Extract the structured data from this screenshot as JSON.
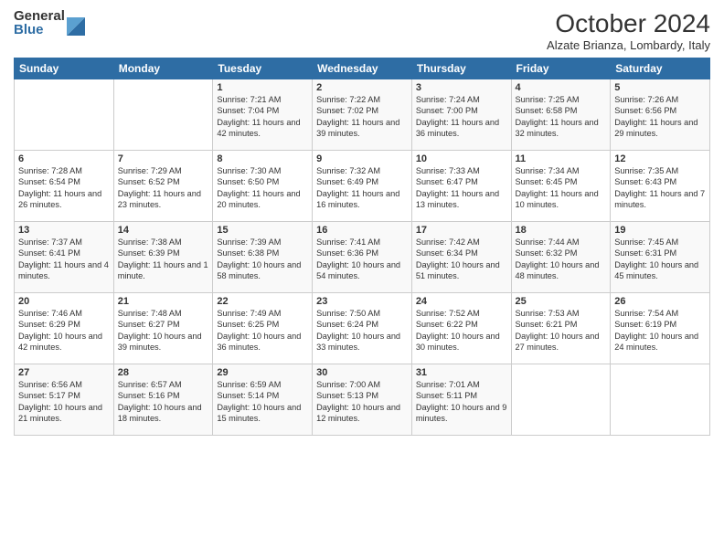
{
  "logo": {
    "general": "General",
    "blue": "Blue"
  },
  "title": "October 2024",
  "subtitle": "Alzate Brianza, Lombardy, Italy",
  "headers": [
    "Sunday",
    "Monday",
    "Tuesday",
    "Wednesday",
    "Thursday",
    "Friday",
    "Saturday"
  ],
  "weeks": [
    [
      {
        "day": "",
        "info": ""
      },
      {
        "day": "",
        "info": ""
      },
      {
        "day": "1",
        "sunrise": "Sunrise: 7:21 AM",
        "sunset": "Sunset: 7:04 PM",
        "daylight": "Daylight: 11 hours and 42 minutes."
      },
      {
        "day": "2",
        "sunrise": "Sunrise: 7:22 AM",
        "sunset": "Sunset: 7:02 PM",
        "daylight": "Daylight: 11 hours and 39 minutes."
      },
      {
        "day": "3",
        "sunrise": "Sunrise: 7:24 AM",
        "sunset": "Sunset: 7:00 PM",
        "daylight": "Daylight: 11 hours and 36 minutes."
      },
      {
        "day": "4",
        "sunrise": "Sunrise: 7:25 AM",
        "sunset": "Sunset: 6:58 PM",
        "daylight": "Daylight: 11 hours and 32 minutes."
      },
      {
        "day": "5",
        "sunrise": "Sunrise: 7:26 AM",
        "sunset": "Sunset: 6:56 PM",
        "daylight": "Daylight: 11 hours and 29 minutes."
      }
    ],
    [
      {
        "day": "6",
        "sunrise": "Sunrise: 7:28 AM",
        "sunset": "Sunset: 6:54 PM",
        "daylight": "Daylight: 11 hours and 26 minutes."
      },
      {
        "day": "7",
        "sunrise": "Sunrise: 7:29 AM",
        "sunset": "Sunset: 6:52 PM",
        "daylight": "Daylight: 11 hours and 23 minutes."
      },
      {
        "day": "8",
        "sunrise": "Sunrise: 7:30 AM",
        "sunset": "Sunset: 6:50 PM",
        "daylight": "Daylight: 11 hours and 20 minutes."
      },
      {
        "day": "9",
        "sunrise": "Sunrise: 7:32 AM",
        "sunset": "Sunset: 6:49 PM",
        "daylight": "Daylight: 11 hours and 16 minutes."
      },
      {
        "day": "10",
        "sunrise": "Sunrise: 7:33 AM",
        "sunset": "Sunset: 6:47 PM",
        "daylight": "Daylight: 11 hours and 13 minutes."
      },
      {
        "day": "11",
        "sunrise": "Sunrise: 7:34 AM",
        "sunset": "Sunset: 6:45 PM",
        "daylight": "Daylight: 11 hours and 10 minutes."
      },
      {
        "day": "12",
        "sunrise": "Sunrise: 7:35 AM",
        "sunset": "Sunset: 6:43 PM",
        "daylight": "Daylight: 11 hours and 7 minutes."
      }
    ],
    [
      {
        "day": "13",
        "sunrise": "Sunrise: 7:37 AM",
        "sunset": "Sunset: 6:41 PM",
        "daylight": "Daylight: 11 hours and 4 minutes."
      },
      {
        "day": "14",
        "sunrise": "Sunrise: 7:38 AM",
        "sunset": "Sunset: 6:39 PM",
        "daylight": "Daylight: 11 hours and 1 minute."
      },
      {
        "day": "15",
        "sunrise": "Sunrise: 7:39 AM",
        "sunset": "Sunset: 6:38 PM",
        "daylight": "Daylight: 10 hours and 58 minutes."
      },
      {
        "day": "16",
        "sunrise": "Sunrise: 7:41 AM",
        "sunset": "Sunset: 6:36 PM",
        "daylight": "Daylight: 10 hours and 54 minutes."
      },
      {
        "day": "17",
        "sunrise": "Sunrise: 7:42 AM",
        "sunset": "Sunset: 6:34 PM",
        "daylight": "Daylight: 10 hours and 51 minutes."
      },
      {
        "day": "18",
        "sunrise": "Sunrise: 7:44 AM",
        "sunset": "Sunset: 6:32 PM",
        "daylight": "Daylight: 10 hours and 48 minutes."
      },
      {
        "day": "19",
        "sunrise": "Sunrise: 7:45 AM",
        "sunset": "Sunset: 6:31 PM",
        "daylight": "Daylight: 10 hours and 45 minutes."
      }
    ],
    [
      {
        "day": "20",
        "sunrise": "Sunrise: 7:46 AM",
        "sunset": "Sunset: 6:29 PM",
        "daylight": "Daylight: 10 hours and 42 minutes."
      },
      {
        "day": "21",
        "sunrise": "Sunrise: 7:48 AM",
        "sunset": "Sunset: 6:27 PM",
        "daylight": "Daylight: 10 hours and 39 minutes."
      },
      {
        "day": "22",
        "sunrise": "Sunrise: 7:49 AM",
        "sunset": "Sunset: 6:25 PM",
        "daylight": "Daylight: 10 hours and 36 minutes."
      },
      {
        "day": "23",
        "sunrise": "Sunrise: 7:50 AM",
        "sunset": "Sunset: 6:24 PM",
        "daylight": "Daylight: 10 hours and 33 minutes."
      },
      {
        "day": "24",
        "sunrise": "Sunrise: 7:52 AM",
        "sunset": "Sunset: 6:22 PM",
        "daylight": "Daylight: 10 hours and 30 minutes."
      },
      {
        "day": "25",
        "sunrise": "Sunrise: 7:53 AM",
        "sunset": "Sunset: 6:21 PM",
        "daylight": "Daylight: 10 hours and 27 minutes."
      },
      {
        "day": "26",
        "sunrise": "Sunrise: 7:54 AM",
        "sunset": "Sunset: 6:19 PM",
        "daylight": "Daylight: 10 hours and 24 minutes."
      }
    ],
    [
      {
        "day": "27",
        "sunrise": "Sunrise: 6:56 AM",
        "sunset": "Sunset: 5:17 PM",
        "daylight": "Daylight: 10 hours and 21 minutes."
      },
      {
        "day": "28",
        "sunrise": "Sunrise: 6:57 AM",
        "sunset": "Sunset: 5:16 PM",
        "daylight": "Daylight: 10 hours and 18 minutes."
      },
      {
        "day": "29",
        "sunrise": "Sunrise: 6:59 AM",
        "sunset": "Sunset: 5:14 PM",
        "daylight": "Daylight: 10 hours and 15 minutes."
      },
      {
        "day": "30",
        "sunrise": "Sunrise: 7:00 AM",
        "sunset": "Sunset: 5:13 PM",
        "daylight": "Daylight: 10 hours and 12 minutes."
      },
      {
        "day": "31",
        "sunrise": "Sunrise: 7:01 AM",
        "sunset": "Sunset: 5:11 PM",
        "daylight": "Daylight: 10 hours and 9 minutes."
      },
      {
        "day": "",
        "info": ""
      },
      {
        "day": "",
        "info": ""
      }
    ]
  ]
}
